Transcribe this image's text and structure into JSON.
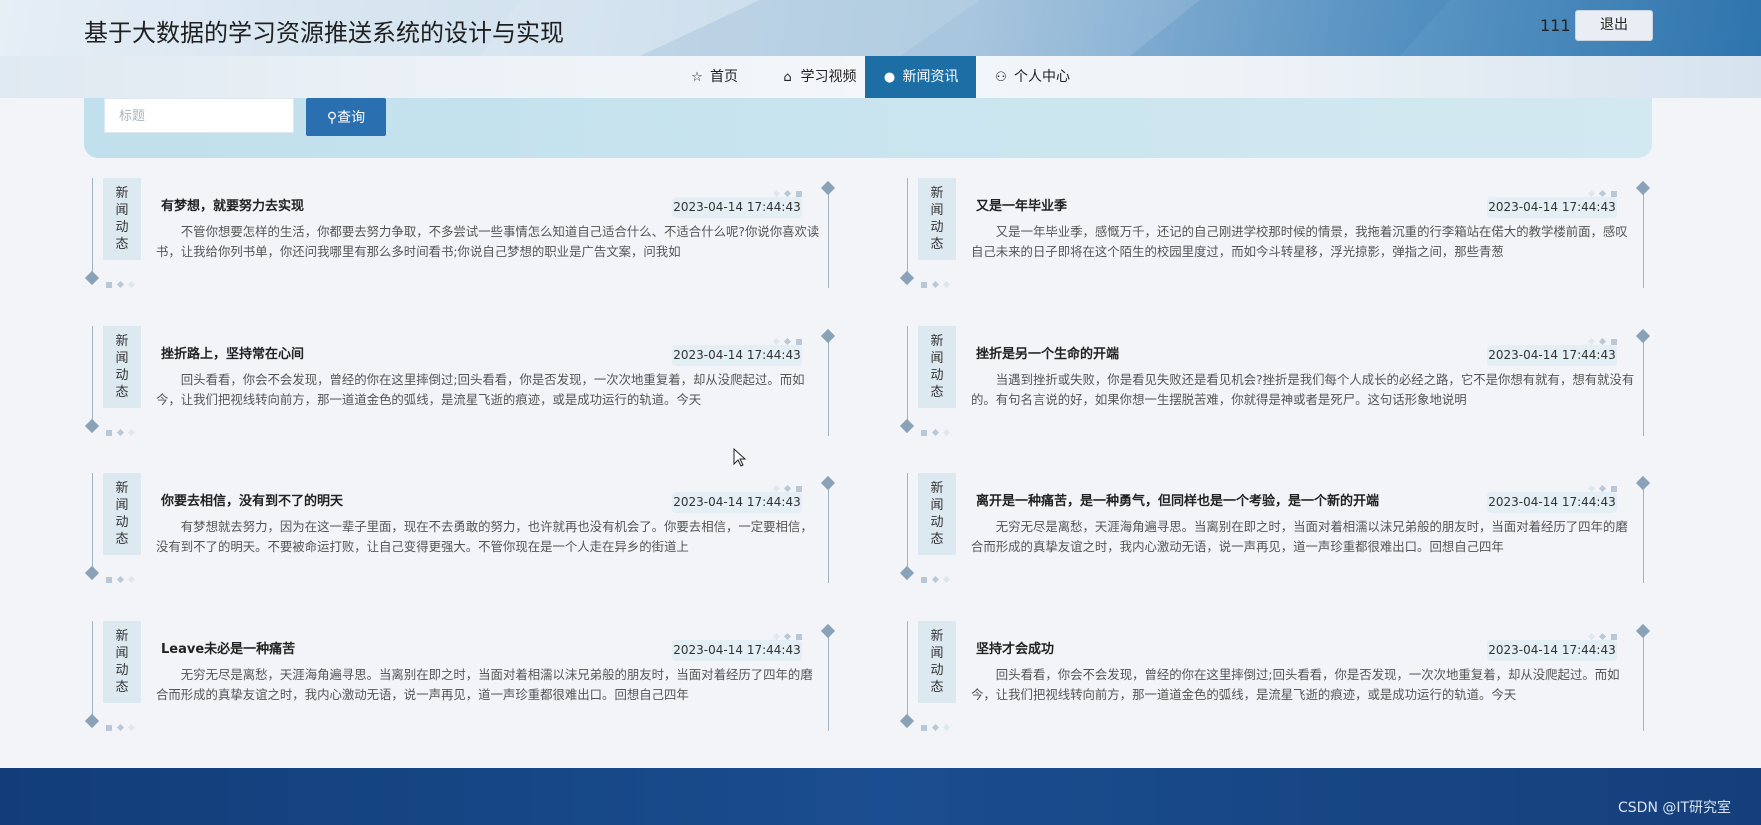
{
  "site": {
    "title": "基于大数据的学习资源推送系统的设计与实现",
    "user_name": "111",
    "logout_label": "退出"
  },
  "nav": {
    "items": [
      {
        "label": "首页",
        "icon": "star-icon",
        "active": false
      },
      {
        "label": "学习视频",
        "icon": "bag-icon",
        "active": false
      },
      {
        "label": "新闻资讯",
        "icon": "info-icon",
        "active": true
      },
      {
        "label": "个人中心",
        "icon": "user-icon",
        "active": false
      }
    ]
  },
  "search": {
    "placeholder": "标题",
    "button_label": "查询",
    "button_icon": "search-icon"
  },
  "news": [
    {
      "tag": "新闻动态",
      "title": "有梦想，就要努力去实现",
      "date": "2023-04-14 17:44:43",
      "summary": "不管你想要怎样的生活，你都要去努力争取，不多尝试一些事情怎么知道自己适合什么、不适合什么呢?你说你喜欢读书，让我给你列书单，你还问我哪里有那么多时间看书;你说自己梦想的职业是广告文案，问我如"
    },
    {
      "tag": "新闻动态",
      "title": "又是一年毕业季",
      "date": "2023-04-14 17:44:43",
      "summary": "又是一年毕业季，感慨万千，还记的自己刚进学校那时候的情景，我拖着沉重的行李箱站在偌大的教学楼前面，感叹自己未来的日子即将在这个陌生的校园里度过，而如今斗转星移，浮光掠影，弹指之间，那些青葱"
    },
    {
      "tag": "新闻动态",
      "title": "挫折路上，坚持常在心间",
      "date": "2023-04-14 17:44:43",
      "summary": "回头看看，你会不会发现，曾经的你在这里摔倒过;回头看看，你是否发现，一次次地重复着，却从没爬起过。而如今，让我们把视线转向前方，那一道道金色的弧线，是流星飞逝的痕迹，或是成功运行的轨道。今天"
    },
    {
      "tag": "新闻动态",
      "title": "挫折是另一个生命的开端",
      "date": "2023-04-14 17:44:43",
      "summary": "当遇到挫折或失败，你是看见失败还是看见机会?挫折是我们每个人成长的必经之路，它不是你想有就有，想有就没有的。有句名言说的好，如果你想一生摆脱苦难，你就得是神或者是死尸。这句话形象地说明"
    },
    {
      "tag": "新闻动态",
      "title": "你要去相信，没有到不了的明天",
      "date": "2023-04-14 17:44:43",
      "summary": "有梦想就去努力，因为在这一辈子里面，现在不去勇敢的努力，也许就再也没有机会了。你要去相信，一定要相信，没有到不了的明天。不要被命运打败，让自己变得更强大。不管你现在是一个人走在异乡的街道上"
    },
    {
      "tag": "新闻动态",
      "title": "离开是一种痛苦，是一种勇气，但同样也是一个考验，是一个新的开端",
      "date": "2023-04-14 17:44:43",
      "summary": "无穷无尽是离愁，天涯海角遍寻思。当离别在即之时，当面对着相濡以沫兄弟般的朋友时，当面对着经历了四年的磨合而形成的真挚友谊之时，我内心激动无语，说一声再见，道一声珍重都很难出口。回想自己四年"
    },
    {
      "tag": "新闻动态",
      "title": "Leave未必是一种痛苦",
      "date": "2023-04-14 17:44:43",
      "summary": "无穷无尽是离愁，天涯海角遍寻思。当离别在即之时，当面对着相濡以沫兄弟般的朋友时，当面对着经历了四年的磨合而形成的真挚友谊之时，我内心激动无语，说一声再见，道一声珍重都很难出口。回想自己四年"
    },
    {
      "tag": "新闻动态",
      "title": "坚持才会成功",
      "date": "2023-04-14 17:44:43",
      "summary": "回头看看，你会不会发现，曾经的你在这里摔倒过;回头看看，你是否发现，一次次地重复着，却从没爬起过。而如今，让我们把视线转向前方，那一道道金色的弧线，是流星飞逝的痕迹，或是成功运行的轨道。今天"
    }
  ],
  "footer": {
    "watermark": "CSDN @IT研究室"
  },
  "colors": {
    "accent": "#1c6ea4",
    "search_button": "#2a6fb0",
    "footer": "#1a4d8f"
  }
}
